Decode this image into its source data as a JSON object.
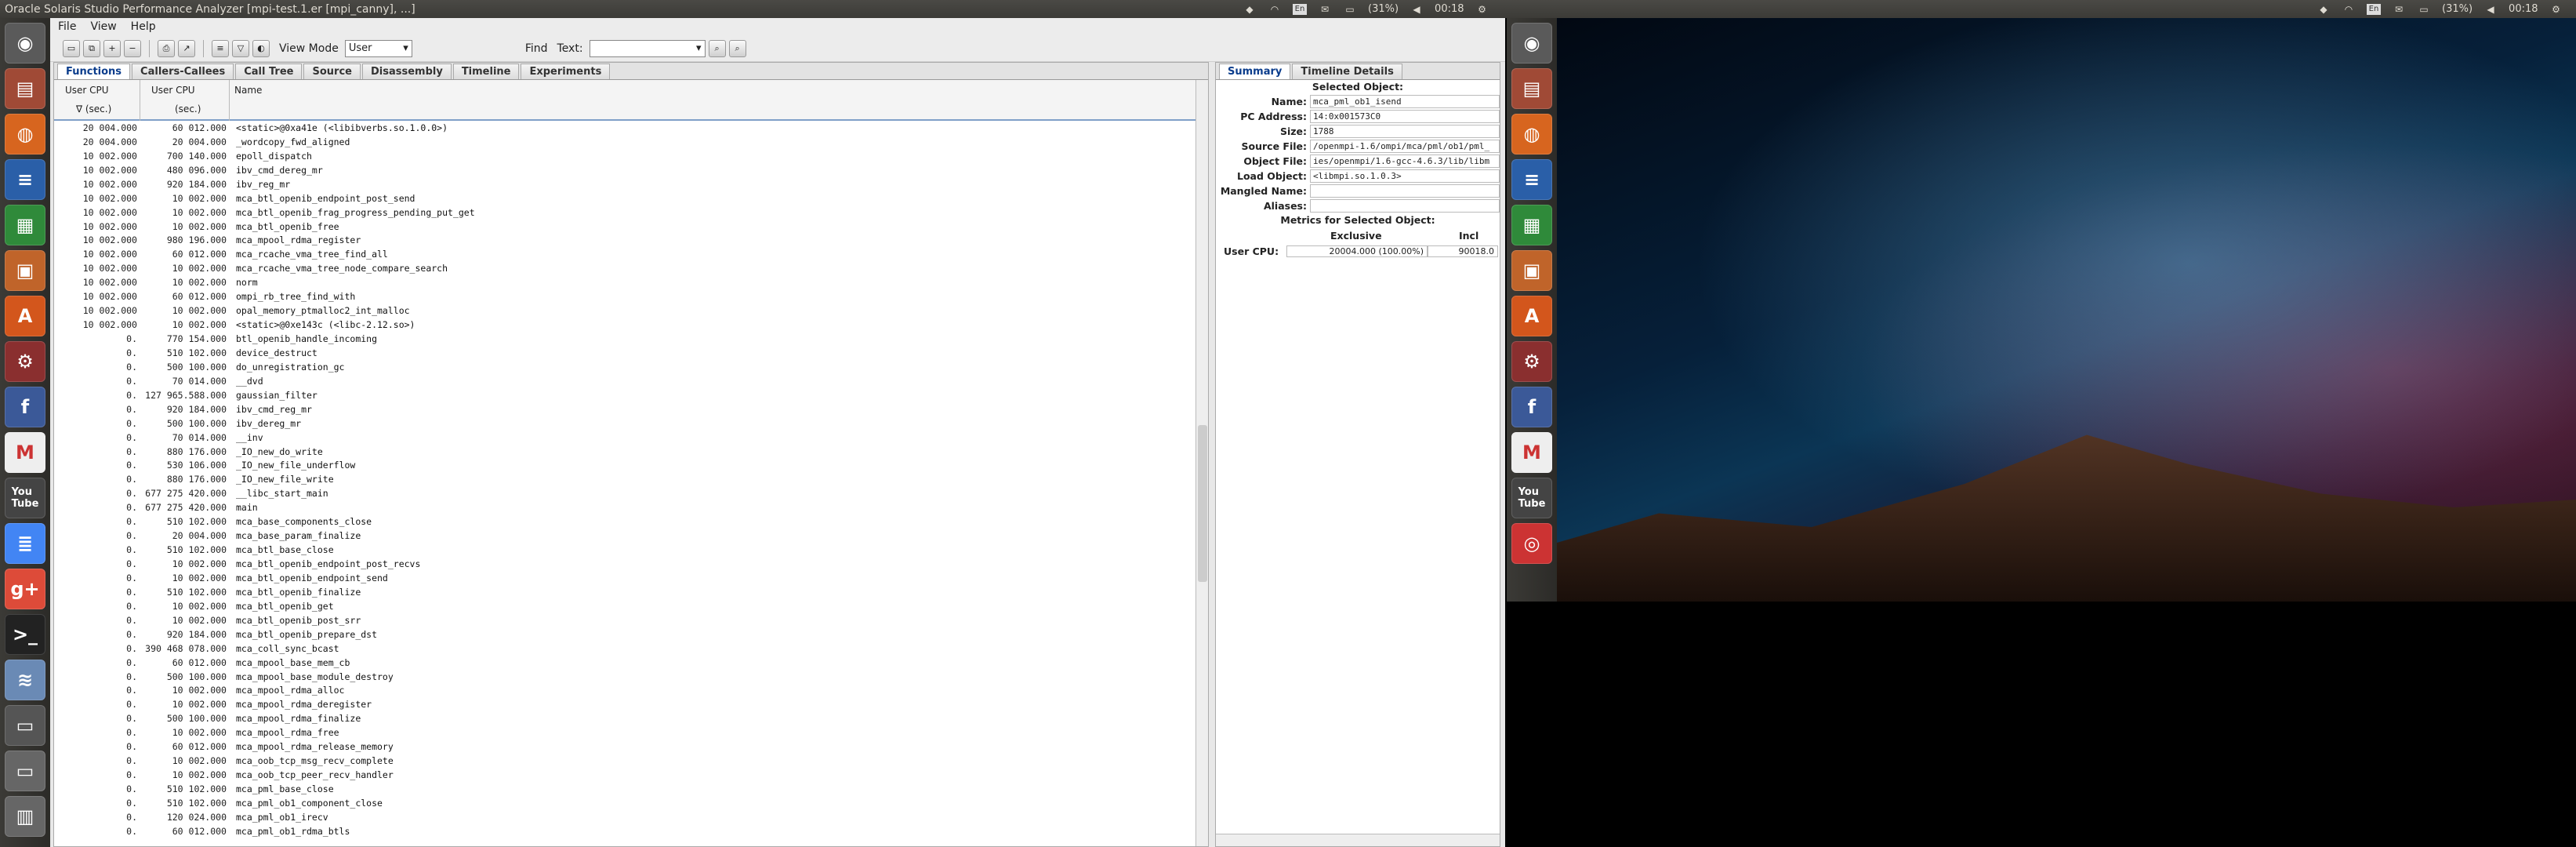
{
  "title": "Oracle Solaris Studio Performance Analyzer [mpi-test.1.er [mpi_canny], ...]",
  "tray_left": {
    "battery": "(31%)",
    "time": "00:18"
  },
  "tray_right": {
    "battery": "(31%)",
    "time": "00:18"
  },
  "menu": [
    "File",
    "View",
    "Help"
  ],
  "toolbar": {
    "view_mode_label": "View Mode",
    "view_mode_value": "User",
    "find_label": "Find",
    "text_label": "Text:"
  },
  "tabs": [
    "Functions",
    "Callers-Callees",
    "Call Tree",
    "Source",
    "Disassembly",
    "Timeline",
    "Experiments"
  ],
  "columns": {
    "c1": "User CPU",
    "c2": "User CPU",
    "c3": "Name",
    "c1_unit": "∇ (sec.)",
    "c2_unit": "(sec.)"
  },
  "rows": [
    [
      "20 004.000",
      "60 012.000",
      "<static>@0xa41e (<libibverbs.so.1.0.0>)"
    ],
    [
      "20 004.000",
      "20 004.000",
      "_wordcopy_fwd_aligned"
    ],
    [
      "10 002.000",
      "700 140.000",
      "epoll_dispatch"
    ],
    [
      "10 002.000",
      "480 096.000",
      "ibv_cmd_dereg_mr"
    ],
    [
      "10 002.000",
      "920 184.000",
      "ibv_reg_mr"
    ],
    [
      "10 002.000",
      "10 002.000",
      "mca_btl_openib_endpoint_post_send"
    ],
    [
      "10 002.000",
      "10 002.000",
      "mca_btl_openib_frag_progress_pending_put_get"
    ],
    [
      "10 002.000",
      "10 002.000",
      "mca_btl_openib_free"
    ],
    [
      "10 002.000",
      "980 196.000",
      "mca_mpool_rdma_register"
    ],
    [
      "10 002.000",
      "60 012.000",
      "mca_rcache_vma_tree_find_all"
    ],
    [
      "10 002.000",
      "10 002.000",
      "mca_rcache_vma_tree_node_compare_search"
    ],
    [
      "10 002.000",
      "10 002.000",
      "norm"
    ],
    [
      "10 002.000",
      "60 012.000",
      "ompi_rb_tree_find_with"
    ],
    [
      "10 002.000",
      "10 002.000",
      "opal_memory_ptmalloc2_int_malloc"
    ],
    [
      "10 002.000",
      "10 002.000",
      "<static>@0xe143c (<libc-2.12.so>)"
    ],
    [
      "0.",
      "770 154.000",
      "btl_openib_handle_incoming"
    ],
    [
      "0.",
      "510 102.000",
      "device_destruct"
    ],
    [
      "0.",
      "500 100.000",
      "do_unregistration_gc"
    ],
    [
      "0.",
      "70 014.000",
      "__dvd"
    ],
    [
      "0.",
      "127 965.588.000",
      "gaussian_filter"
    ],
    [
      "0.",
      "920 184.000",
      "ibv_cmd_reg_mr"
    ],
    [
      "0.",
      "500 100.000",
      "ibv_dereg_mr"
    ],
    [
      "0.",
      "70 014.000",
      "__inv"
    ],
    [
      "0.",
      "880 176.000",
      "_IO_new_do_write"
    ],
    [
      "0.",
      "530 106.000",
      "_IO_new_file_underflow"
    ],
    [
      "0.",
      "880 176.000",
      "_IO_new_file_write"
    ],
    [
      "0.",
      "677 275 420.000",
      "__libc_start_main"
    ],
    [
      "0.",
      "677 275 420.000",
      "main"
    ],
    [
      "0.",
      "510 102.000",
      "mca_base_components_close"
    ],
    [
      "0.",
      "20 004.000",
      "mca_base_param_finalize"
    ],
    [
      "0.",
      "510 102.000",
      "mca_btl_base_close"
    ],
    [
      "0.",
      "10 002.000",
      "mca_btl_openib_endpoint_post_recvs"
    ],
    [
      "0.",
      "10 002.000",
      "mca_btl_openib_endpoint_send"
    ],
    [
      "0.",
      "510 102.000",
      "mca_btl_openib_finalize"
    ],
    [
      "0.",
      "10 002.000",
      "mca_btl_openib_get"
    ],
    [
      "0.",
      "10 002.000",
      "mca_btl_openib_post_srr"
    ],
    [
      "0.",
      "920 184.000",
      "mca_btl_openib_prepare_dst"
    ],
    [
      "0.",
      "390 468 078.000",
      "mca_coll_sync_bcast"
    ],
    [
      "0.",
      "60 012.000",
      "mca_mpool_base_mem_cb"
    ],
    [
      "0.",
      "500 100.000",
      "mca_mpool_base_module_destroy"
    ],
    [
      "0.",
      "10 002.000",
      "mca_mpool_rdma_alloc"
    ],
    [
      "0.",
      "10 002.000",
      "mca_mpool_rdma_deregister"
    ],
    [
      "0.",
      "500 100.000",
      "mca_mpool_rdma_finalize"
    ],
    [
      "0.",
      "10 002.000",
      "mca_mpool_rdma_free"
    ],
    [
      "0.",
      "60 012.000",
      "mca_mpool_rdma_release_memory"
    ],
    [
      "0.",
      "10 002.000",
      "mca_oob_tcp_msg_recv_complete"
    ],
    [
      "0.",
      "10 002.000",
      "mca_oob_tcp_peer_recv_handler"
    ],
    [
      "0.",
      "510 102.000",
      "mca_pml_base_close"
    ],
    [
      "0.",
      "510 102.000",
      "mca_pml_ob1_component_close"
    ],
    [
      "0.",
      "120 024.000",
      "mca_pml_ob1_irecv"
    ],
    [
      "0.",
      "60 012.000",
      "mca_pml_ob1_rdma_btls"
    ]
  ],
  "summary": {
    "tabs": [
      "Summary",
      "Timeline Details"
    ],
    "selected_header": "Selected Object:",
    "fields": [
      {
        "k": "Name:",
        "v": "mca_pml_ob1_isend"
      },
      {
        "k": "PC Address:",
        "v": "14:0x001573C0"
      },
      {
        "k": "Size:",
        "v": "1788"
      },
      {
        "k": "Source File:",
        "v": "/openmpi-1.6/ompi/mca/pml/ob1/pml_"
      },
      {
        "k": "Object File:",
        "v": "ies/openmpi/1.6-gcc-4.6.3/lib/libm"
      },
      {
        "k": "Load Object:",
        "v": "<libmpi.so.1.0.3>"
      },
      {
        "k": "Mangled Name:",
        "v": ""
      },
      {
        "k": "Aliases:",
        "v": ""
      }
    ],
    "metrics_header": "Metrics for Selected Object:",
    "exclusive_label": "Exclusive",
    "inclusive_label": "Incl",
    "metric_name": "User CPU:",
    "exclusive_value": "20004.000 (100.00%)",
    "inclusive_value": "90018.0"
  },
  "launcher_icons": [
    "ubuntu-dash-icon",
    "files-icon",
    "firefox-icon",
    "writer-icon",
    "calc-icon",
    "impress-icon",
    "software-center-icon",
    "settings-icon",
    "facebook-icon",
    "gmail-icon",
    "youtube-icon",
    "docs-icon",
    "google-plus-icon",
    "terminal-icon",
    "analyzer-icon",
    "drive-icon",
    "drive2-icon",
    "trash-icon"
  ],
  "colors": {
    "panel": "#3c3b37",
    "accent": "#0a3c8c",
    "header_line": "#7f9fc8"
  }
}
